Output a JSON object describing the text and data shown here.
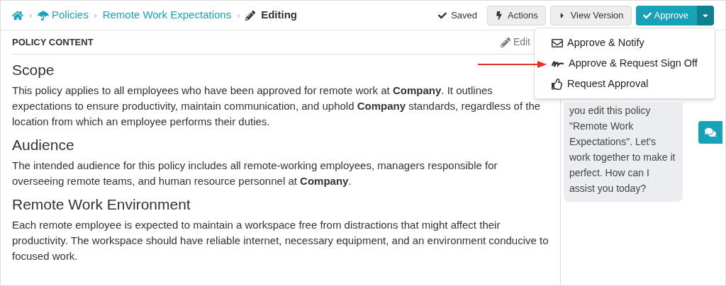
{
  "breadcrumbs": [
    {
      "kind": "home"
    },
    {
      "kind": "separator",
      "label": "›"
    },
    {
      "kind": "link",
      "label": "Policies"
    },
    {
      "kind": "separator",
      "label": "›"
    },
    {
      "kind": "link",
      "label": "Remote Work Expectations"
    },
    {
      "kind": "separator",
      "label": "›"
    },
    {
      "kind": "current",
      "label": "Editing"
    }
  ],
  "toolbar": {
    "status": "Saved",
    "buttons": [
      {
        "kind": "actions",
        "label": "Actions"
      },
      {
        "kind": "view",
        "label": "View Version"
      }
    ],
    "primary": {
      "label": "Approve"
    }
  },
  "approve_menu": {
    "expanded": true,
    "items": [
      {
        "kind": "mail",
        "label": "Approve & Notify"
      },
      {
        "kind": "signature",
        "label": "Approve & Request Sign Off"
      },
      {
        "kind": "thumb",
        "label": "Request Approval"
      }
    ]
  },
  "panel": {
    "title": "POLICY CONTENT",
    "edit_label": "Edit"
  },
  "sections": [
    {
      "heading": "Scope",
      "text": "This policy applies to all employees who have been approved for remote work at **Company**. It outlines expectations to ensure productivity, maintain communication, and uphold **Company** standards, regardless of the location from which an employee performs their duties."
    },
    {
      "heading": "Audience",
      "text": "The intended audience for this policy includes all remote-working employees, managers responsible for overseeing remote teams, and human resource personnel at **Company**."
    },
    {
      "heading": "Remote Work Environment",
      "text": "Each remote employee is expected to maintain a workspace free from distractions that might affect their productivity. The workspace should have reliable internet, necessary equipment, and an environment conducive to focused work."
    }
  ],
  "chat": {
    "message": "you edit this policy \"Remote Work Expectations\". Let's work together to make it perfect. How can I assist you today?"
  }
}
